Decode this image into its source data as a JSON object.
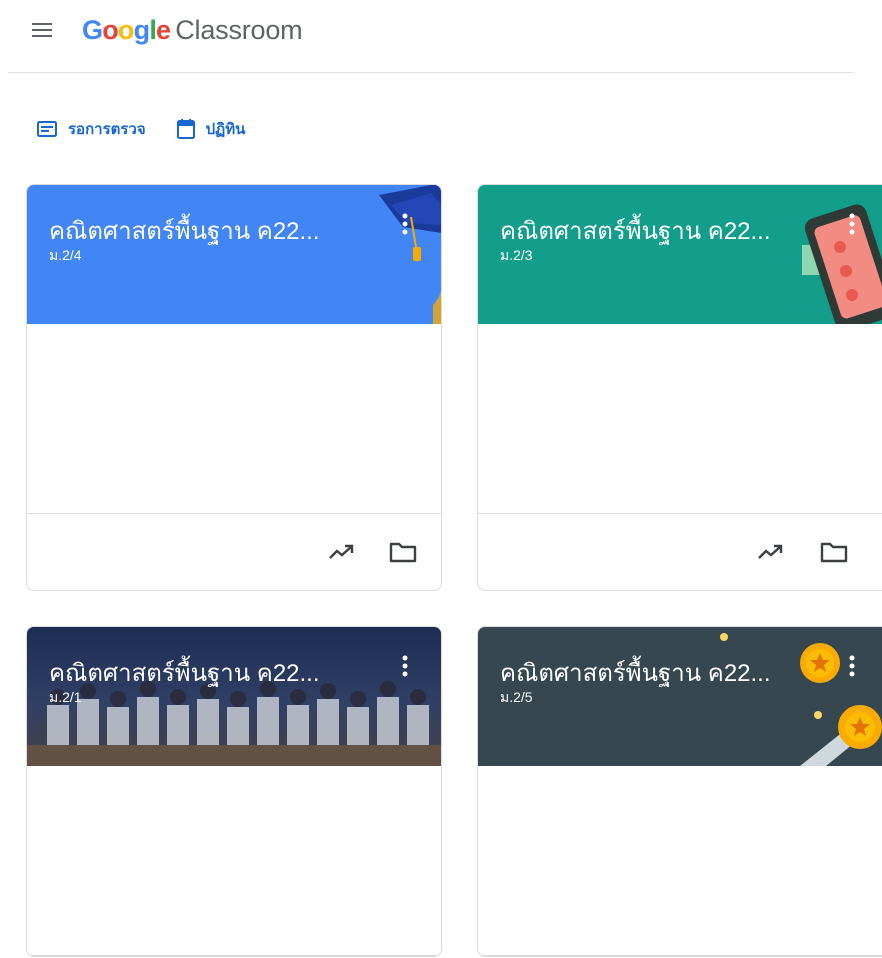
{
  "app": {
    "logo_google": [
      "G",
      "o",
      "o",
      "g",
      "l",
      "e"
    ],
    "logo_product": "Classroom"
  },
  "colors": {
    "google_blue": "#4285f4",
    "google_red": "#ea4335",
    "google_yellow": "#fbbc04",
    "google_green": "#34a853",
    "link_blue": "#1967d2"
  },
  "quicklinks": [
    {
      "label": "รอการตรวจ",
      "icon": "assignment-icon"
    },
    {
      "label": "ปฏิทิน",
      "icon": "calendar-icon"
    }
  ],
  "classes": [
    {
      "title": "คณิตศาสตร์พื้นฐาน ค22...",
      "section": "ม.2/4",
      "theme": "graduation",
      "color": "#4285f4"
    },
    {
      "title": "คณิตศาสตร์พื้นฐาน ค22...",
      "section": "ม.2/3",
      "theme": "phone",
      "color": "#129e8a"
    },
    {
      "title": "คณิตศาสตร์พื้นฐาน ค22...",
      "section": "ม.2/1",
      "theme": "photo",
      "color": "#2e3a55"
    },
    {
      "title": "คณิตศาสตร์พื้นฐาน ค22...",
      "section": "ม.2/5",
      "theme": "coins",
      "color": "#37474f"
    }
  ]
}
